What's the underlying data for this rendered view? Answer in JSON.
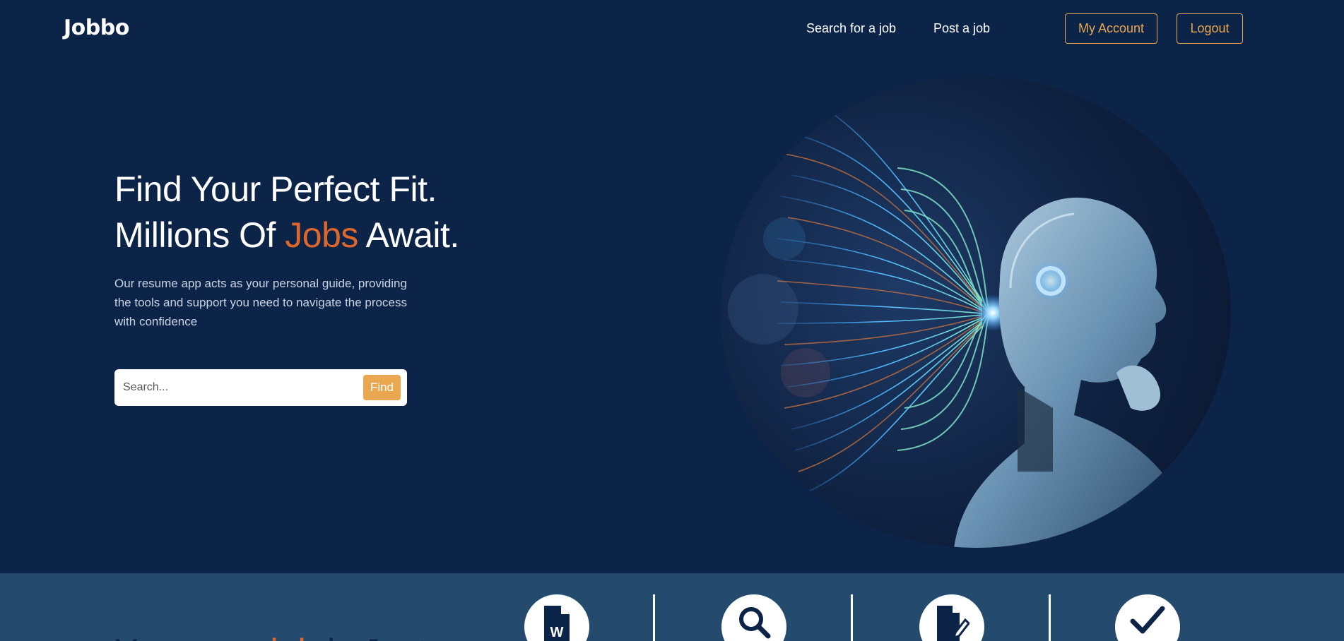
{
  "header": {
    "logo": "Jobbo",
    "nav": {
      "search_job": "Search for a job",
      "post_job": "Post a job"
    },
    "my_account": "My Account",
    "logout": "Logout"
  },
  "hero": {
    "title_line1": "Find Your Perfect Fit.",
    "title_line2_pre": "Millions Of ",
    "title_line2_accent": "Jobs",
    "title_line2_post": " Await.",
    "description": "Our resume app acts as your personal guide, providing the tools and support you need to navigate the process with confidence",
    "search": {
      "placeholder": "Search...",
      "button": "Find"
    },
    "image_alt": "robot-illustration"
  },
  "features": {
    "heading_pre": "Your new ",
    "heading_accent": "job",
    "heading_post": " is Just",
    "icons": [
      "word-document-icon",
      "search-icon",
      "edit-document-icon",
      "checkmark-icon"
    ]
  },
  "colors": {
    "background": "#0b2447",
    "accent_orange": "#e0672c",
    "button_gold": "#e9a84f",
    "features_strip": "#244a6e"
  }
}
